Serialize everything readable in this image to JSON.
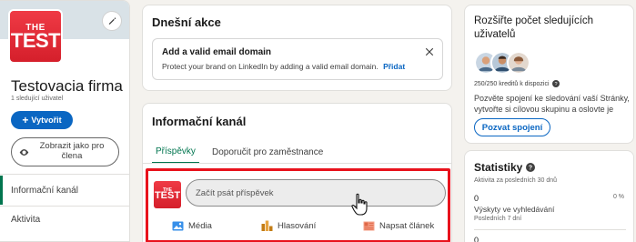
{
  "colors": {
    "page_bg": "#f4f2ee",
    "card_bg": "#ffffff",
    "accent_blue": "#0a66c2",
    "accent_green": "#01754f",
    "highlight_red": "#e8121c",
    "logo_red": "#e32b36"
  },
  "company": {
    "logo_top": "THE",
    "logo_bottom": "TEST",
    "name": "Testovacia firma",
    "followers": "1 sledující uživatel",
    "create_label": "Vytvořit",
    "view_as_label": "Zobrazit jako pro člena",
    "edit_icon": "pencil-icon"
  },
  "left_nav": {
    "items": [
      {
        "label": "Informační kanál",
        "active": true
      },
      {
        "label": "Aktivita",
        "active": false
      }
    ]
  },
  "today": {
    "title": "Dnešní akce",
    "alert_title": "Add a valid email domain",
    "alert_desc": "Protect your brand on LinkedIn by adding a valid email domain.",
    "alert_action": "Přidat"
  },
  "feed": {
    "title": "Informační kanál",
    "tabs": [
      {
        "label": "Příspěvky",
        "active": true
      },
      {
        "label": "Doporučit pro zaměstnance",
        "active": false
      }
    ],
    "post_placeholder": "Začít psát příspěvek",
    "actions": [
      {
        "label": "Média",
        "icon": "image-icon",
        "color": "#378fe9"
      },
      {
        "label": "Hlasování",
        "icon": "poll-icon",
        "color": "#c37d16"
      },
      {
        "label": "Napsat článek",
        "icon": "article-icon",
        "color": "#e06847"
      }
    ]
  },
  "grow": {
    "title": "Rozšiřte počet sledujících uživatelů",
    "credits": "250/250 kreditů k dispozici",
    "desc_line1": "Pozvěte spojení ke sledování vaší Stránky,",
    "desc_line2": "vytvořte si cílovou skupinu a oslovte je",
    "invite_label": "Pozvat spojení"
  },
  "stats": {
    "title": "Statistiky",
    "subtitle": "Aktivita za posledních 30 dnů",
    "value": "0",
    "percent": "0 %",
    "label": "Výskyty ve vyhledávání",
    "period": "Posledních 7 dní",
    "value_2": "0"
  }
}
